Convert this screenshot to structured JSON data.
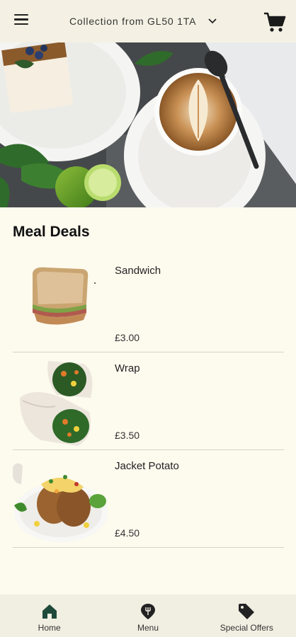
{
  "header": {
    "location_label": "Collection from GL50 1TA"
  },
  "section": {
    "title": "Meal Deals"
  },
  "items": [
    {
      "name": "Sandwich",
      "price": "£3.00"
    },
    {
      "name": "Wrap",
      "price": "£3.50"
    },
    {
      "name": "Jacket Potato",
      "price": "£4.50"
    }
  ],
  "nav": {
    "tabs": [
      {
        "label": "Home",
        "icon": "home-icon"
      },
      {
        "label": "Menu",
        "icon": "menu-pin-icon"
      },
      {
        "label": "Special Offers",
        "icon": "tag-icon"
      }
    ]
  },
  "colors": {
    "background": "#fdfaee",
    "header": "#f4f1e4",
    "nav_active": "#1f4a3a"
  }
}
